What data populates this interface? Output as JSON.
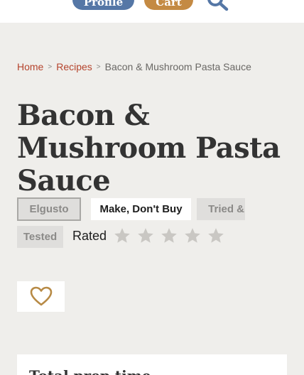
{
  "header": {
    "profile_label": "Profile",
    "cart_label": "Cart",
    "search_icon": "search-icon"
  },
  "breadcrumb": {
    "items": [
      "Home",
      "Recipes"
    ],
    "separator": ">",
    "current": "Bacon & Mushroom Pasta Sauce"
  },
  "recipe": {
    "title": "Bacon & Mushroom Pasta Sauce",
    "tags": [
      "Elgusto",
      "Make, Don't Buy",
      "Tried &",
      "Tested"
    ],
    "rating_label": "Rated",
    "rating_value": 0,
    "rating_max": 5,
    "favorite_icon": "heart-icon"
  },
  "card": {
    "title": "Total prep time"
  },
  "colors": {
    "background": "#efeeeb",
    "link": "#b5442d",
    "profile_button": "#5577a6",
    "cart_button": "#c48a43",
    "heart": "#b78a45",
    "star_empty": "#c9c7c3"
  }
}
